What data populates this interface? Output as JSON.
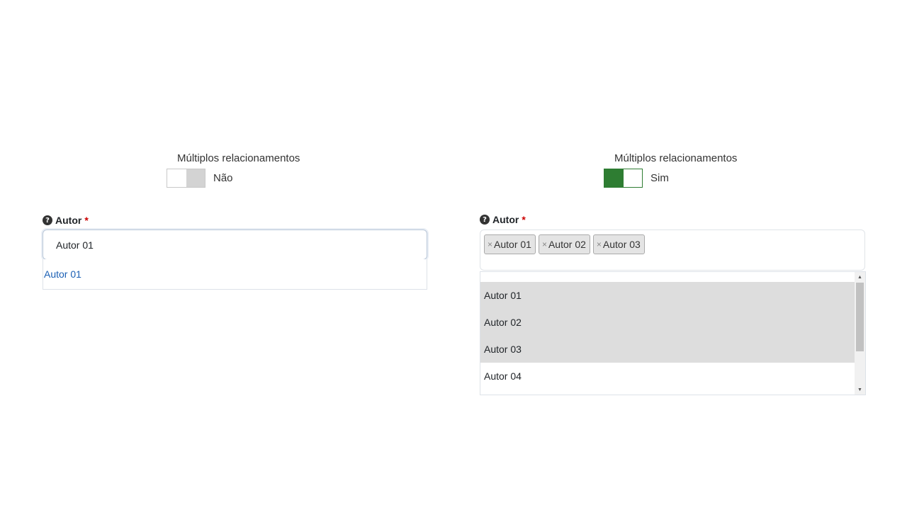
{
  "left": {
    "toggle": {
      "title": "Múltiplos relacionamentos",
      "state_label": "Não",
      "on": false
    },
    "field": {
      "help_icon": "question-circle-icon",
      "label": "Autor",
      "required_mark": "*",
      "input_value": "Autor 01",
      "dropdown_options": [
        "Autor 01"
      ]
    }
  },
  "right": {
    "toggle": {
      "title": "Múltiplos relacionamentos",
      "state_label": "Sim",
      "on": true
    },
    "field": {
      "help_icon": "question-circle-icon",
      "label": "Autor",
      "required_mark": "*",
      "remove_glyph": "×",
      "tags": [
        "Autor 01",
        "Autor 02",
        "Autor 03"
      ],
      "options": [
        {
          "label": "Autor 01",
          "selected": true
        },
        {
          "label": "Autor 02",
          "selected": true
        },
        {
          "label": "Autor 03",
          "selected": true
        },
        {
          "label": "Autor 04",
          "selected": false
        }
      ]
    }
  },
  "colors": {
    "toggle_on": "#2e7d32",
    "toggle_off": "#d3d3d3",
    "link": "#1a5fb4",
    "required": "#cc0000"
  }
}
